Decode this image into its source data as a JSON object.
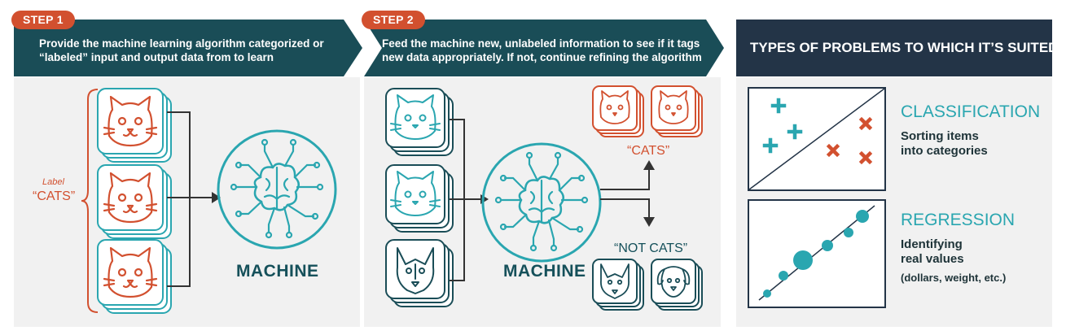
{
  "step1": {
    "pill": "STEP 1",
    "text_line1": "Provide the machine learning algorithm categorized or",
    "text_line2": "“labeled” input and output data from to learn",
    "label_word": "Label",
    "label_value": "“CATS”",
    "machine": "MACHINE"
  },
  "step2": {
    "pill": "STEP 2",
    "text_line1": "Feed the machine new, unlabeled information to see if it tags",
    "text_line2": "new data appropriately. If not, continue refining the algorithm",
    "machine": "MACHINE",
    "cats_output": "“CATS”",
    "not_cats_output": "“NOT CATS”"
  },
  "types": {
    "title": "TYPES OF PROBLEMS TO WHICH IT’S SUITED",
    "classification": {
      "title": "CLASSIFICATION",
      "desc_line1": "Sorting items",
      "desc_line2": "into categories"
    },
    "regression": {
      "title": "REGRESSION",
      "desc_line1": "Identifying",
      "desc_line2": "real values",
      "desc_line3": "(dollars, weight, etc.)"
    }
  },
  "colors": {
    "dark_teal": "#1a4d57",
    "teal": "#2aa6b0",
    "orange": "#d2502f",
    "navy": "#233447",
    "panel_bg": "#f1f1f1"
  },
  "icons": {
    "input_cats": [
      "cat-face-icon",
      "cat-face-icon",
      "cat-face-icon"
    ],
    "step2_inputs": [
      "cat-face-icon",
      "cat-face-icon",
      "dog-face-icon"
    ],
    "cats_outputs": [
      "cat-face-icon",
      "cat-face-icon"
    ],
    "not_cats_outputs": [
      "dog-face-icon",
      "dog-face-icon"
    ],
    "machine": "brain-circuit-icon"
  }
}
